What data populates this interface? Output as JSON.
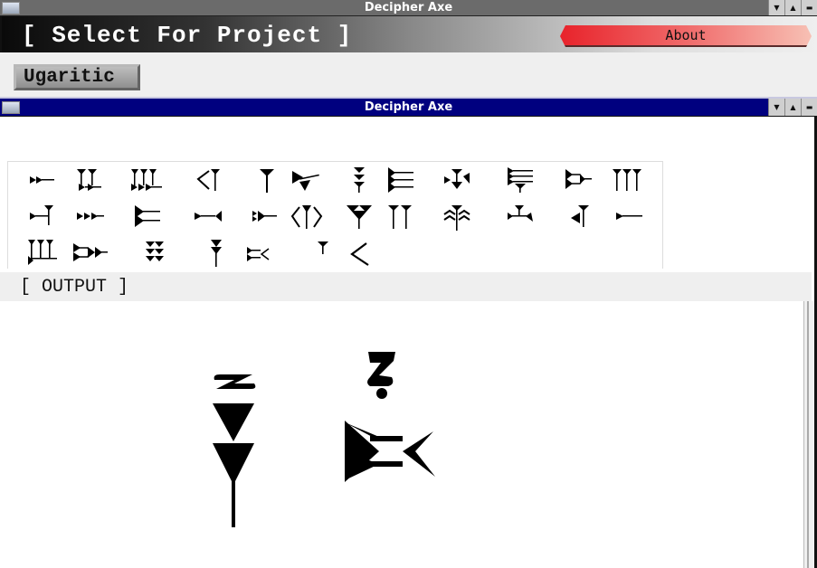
{
  "window": {
    "title": "Decipher Axe",
    "buttons": [
      "minimize",
      "maximize",
      "close"
    ]
  },
  "header": {
    "title": "[ Select For Project ]",
    "about_label": "About"
  },
  "project_button": {
    "label": "Ugaritic"
  },
  "subwindow": {
    "title": "Decipher Axe"
  },
  "keyboard": {
    "rows": [
      [
        "glyph-1",
        "glyph-2",
        "glyph-3",
        "glyph-4",
        "glyph-5",
        "glyph-6",
        "glyph-7",
        "glyph-8",
        "glyph-9",
        "glyph-10",
        "glyph-11",
        "glyph-12"
      ],
      [
        "glyph-13",
        "glyph-14",
        "glyph-15",
        "glyph-16",
        "glyph-17",
        "glyph-18",
        "glyph-19",
        "glyph-20",
        "glyph-21",
        "glyph-22",
        "glyph-23",
        "glyph-24"
      ],
      [
        "glyph-25",
        "glyph-26",
        "glyph-27",
        "glyph-28",
        "glyph-29",
        "glyph-30",
        "glyph-31"
      ]
    ]
  },
  "output": {
    "label": "[ OUTPUT ]",
    "glyphs": [
      {
        "transliteration": "z",
        "sign": "double-wedge-vertical"
      },
      {
        "transliteration": "ẓ",
        "sign": "wedges-with-angle"
      }
    ]
  },
  "colors": {
    "title_bar": "#6b6b6b",
    "subwindow_title_bar": "#00007f",
    "about_button": "#e8232b"
  }
}
